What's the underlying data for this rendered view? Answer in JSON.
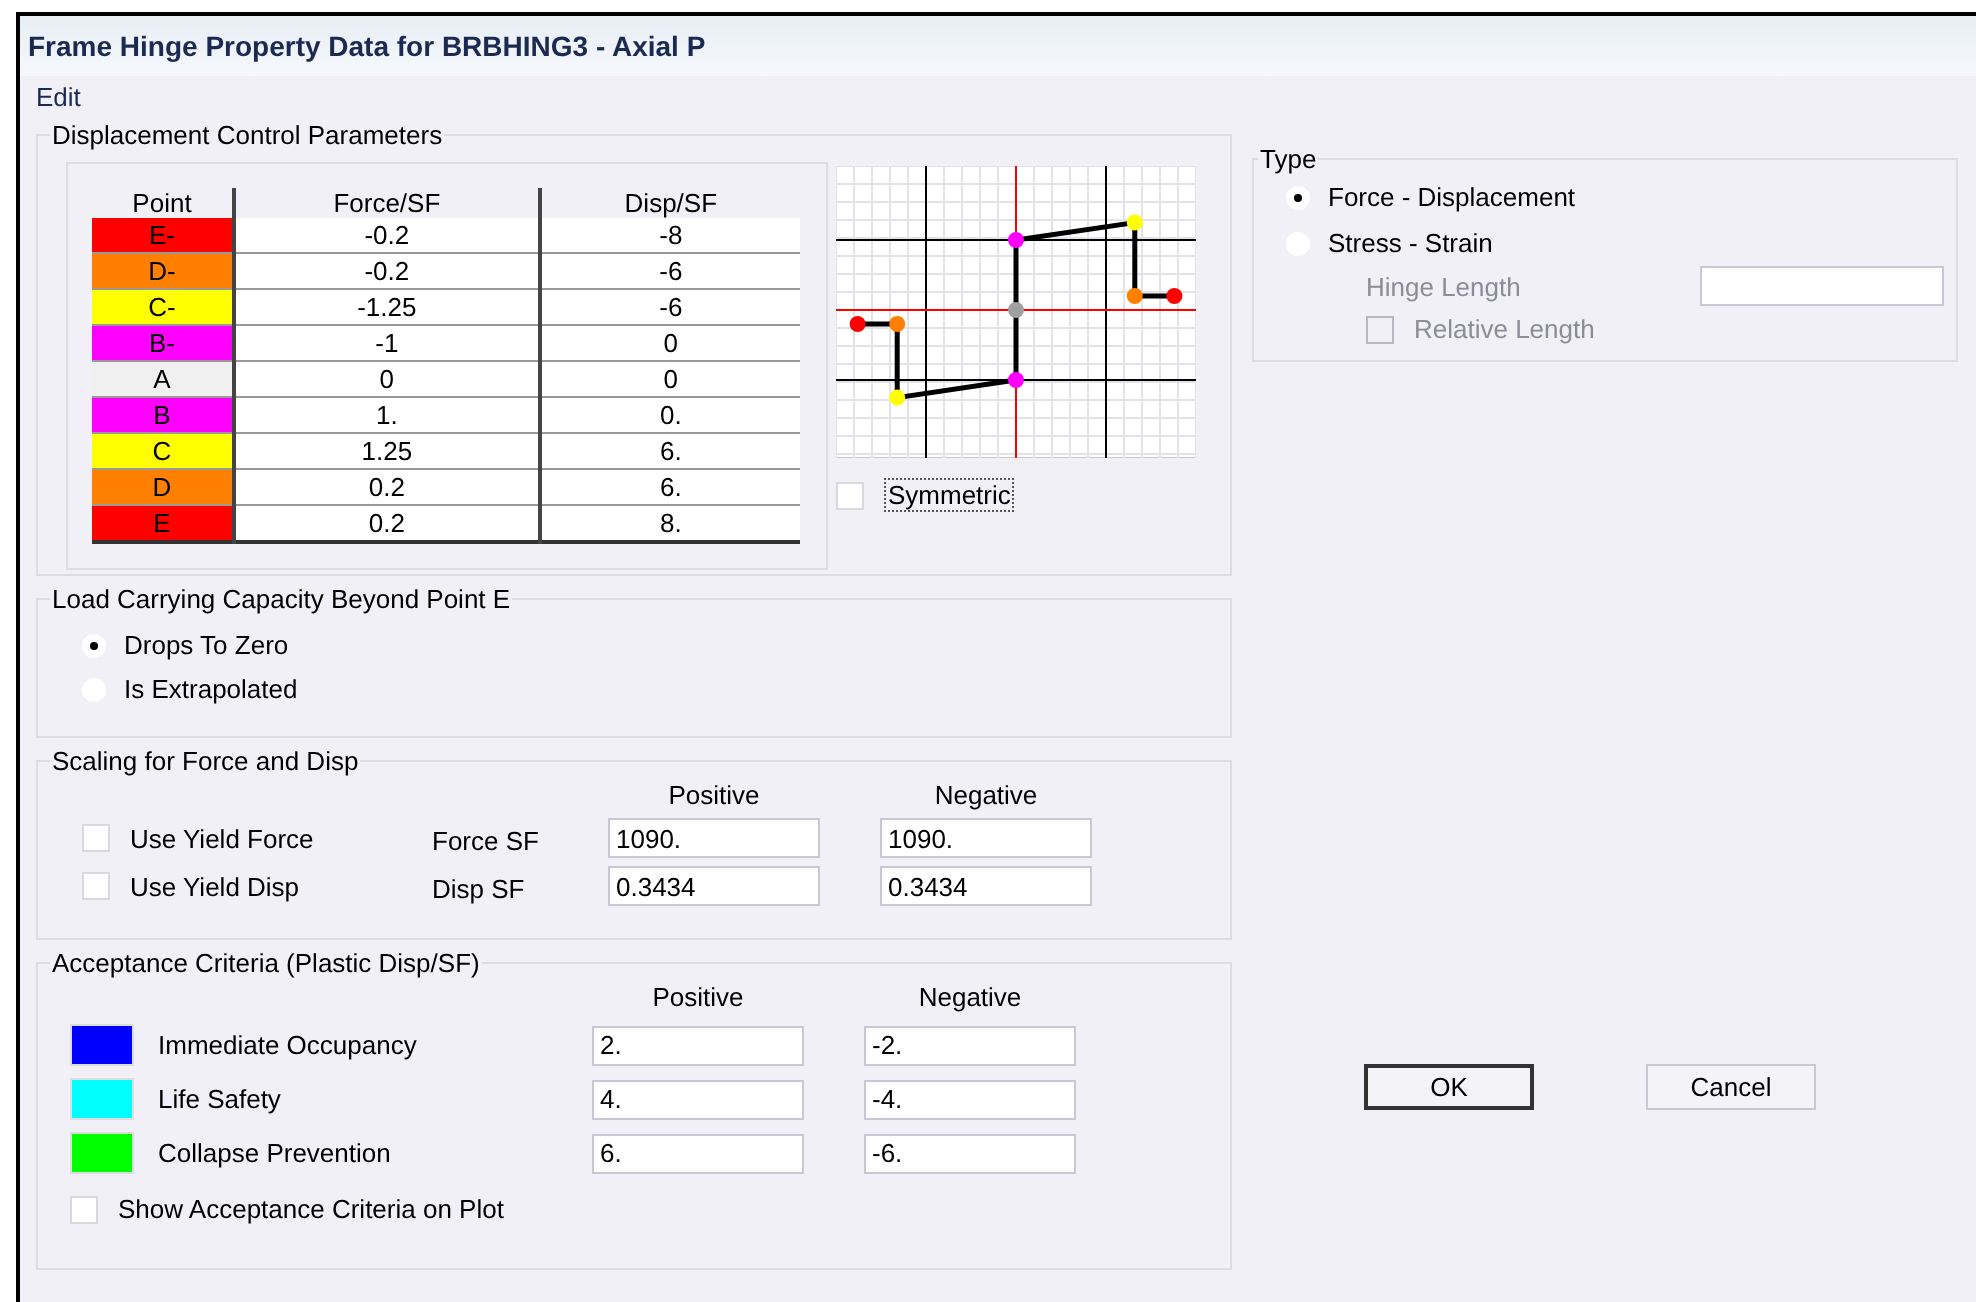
{
  "window": {
    "title": "Frame Hinge Property Data for BRBHING3 - Axial P"
  },
  "menu": [
    "Edit"
  ],
  "displacement_control": {
    "title": "Displacement Control Parameters",
    "table": {
      "columns": [
        "Point",
        "Force/SF",
        "Disp/SF"
      ],
      "rows": [
        {
          "point": "E-",
          "color": "#ff0000",
          "force": "-0.2",
          "disp": "-8"
        },
        {
          "point": "D-",
          "color": "#ff8000",
          "force": "-0.2",
          "disp": "-6"
        },
        {
          "point": "C-",
          "color": "#ffff00",
          "force": "-1.25",
          "disp": "-6"
        },
        {
          "point": "B-",
          "color": "#ff00ff",
          "force": "-1",
          "disp": "0"
        },
        {
          "point": "A",
          "color": "#f0f0f0",
          "force": "0",
          "disp": "0"
        },
        {
          "point": "B",
          "color": "#ff00ff",
          "force": "1.",
          "disp": "0."
        },
        {
          "point": "C",
          "color": "#ffff00",
          "force": "1.25",
          "disp": "6."
        },
        {
          "point": "D",
          "color": "#ff8000",
          "force": "0.2",
          "disp": "6."
        },
        {
          "point": "E",
          "color": "#ff0000",
          "force": "0.2",
          "disp": "8."
        }
      ]
    },
    "symmetric": {
      "label": "Symmetric",
      "checked": false
    }
  },
  "load_beyond_e": {
    "title": "Load Carrying Capacity Beyond Point E",
    "options": [
      {
        "label": "Drops To Zero",
        "selected": true
      },
      {
        "label": "Is Extrapolated",
        "selected": false
      }
    ]
  },
  "scaling": {
    "title": "Scaling for Force and Disp",
    "headers": [
      "Positive",
      "Negative"
    ],
    "rows": [
      {
        "checkbox_label": "Use Yield Force",
        "checked": false,
        "label": "Force SF",
        "positive": "1090.",
        "negative": "1090."
      },
      {
        "checkbox_label": "Use Yield Disp",
        "checked": false,
        "label": "Disp SF",
        "positive": "0.3434",
        "negative": "0.3434"
      }
    ]
  },
  "acceptance": {
    "title": "Acceptance Criteria (Plastic Disp/SF)",
    "headers": [
      "Positive",
      "Negative"
    ],
    "rows": [
      {
        "label": "Immediate Occupancy",
        "color": "#0000ff",
        "positive": "2.",
        "negative": "-2."
      },
      {
        "label": "Life Safety",
        "color": "#00ffff",
        "positive": "4.",
        "negative": "-4."
      },
      {
        "label": "Collapse Prevention",
        "color": "#00ff00",
        "positive": "6.",
        "negative": "-6."
      }
    ],
    "show_on_plot": {
      "label": "Show Acceptance Criteria on Plot",
      "checked": false
    }
  },
  "type": {
    "title": "Type",
    "options": [
      {
        "label": "Force - Displacement",
        "selected": true
      },
      {
        "label": "Stress - Strain",
        "selected": false
      }
    ],
    "hinge_length": {
      "label": "Hinge Length",
      "disabled": true
    },
    "relative_length": {
      "label": "Relative Length",
      "checked": false,
      "disabled": true
    }
  },
  "buttons": [
    {
      "label": "OK",
      "default": true
    },
    {
      "label": "Cancel",
      "default": false
    }
  ]
}
